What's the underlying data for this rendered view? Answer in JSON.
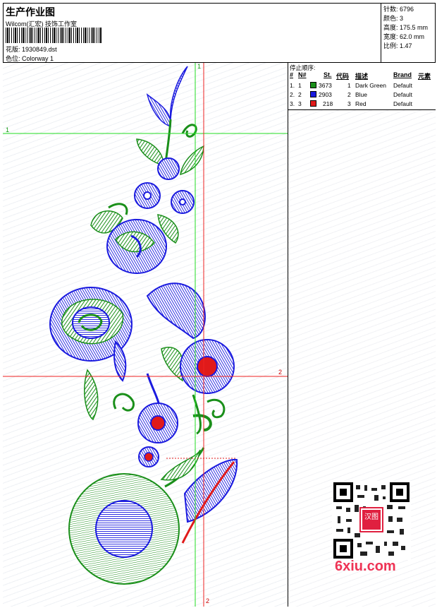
{
  "header": {
    "title": "生产作业图",
    "company": "Wilcom(汇宏) 技饰工作室",
    "file_label": "花版:",
    "file_name": "1930849.dst",
    "colorway_label": "色位:",
    "colorway_name": "Colorway 1"
  },
  "stats": {
    "stitches_label": "针数:",
    "stitches_value": "6796",
    "colors_label": "颜色:",
    "colors_value": "3",
    "height_label": "高度:",
    "height_value": "175.5 mm",
    "width_label": "宽度:",
    "width_value": "62.0 mm",
    "ratio_label": "比例:",
    "ratio_value": "1.47"
  },
  "stop_sequence": {
    "title": "停止顺序:",
    "headers": {
      "num": "#",
      "needle": "N#",
      "stitches": "St.",
      "code": "代码",
      "desc": "描述",
      "brand": "Brand",
      "element": "元素"
    },
    "rows": [
      {
        "num": "1.",
        "needle": "1",
        "stitches": "3673",
        "code": "1",
        "desc": "Dark Green",
        "brand": "Default",
        "color": "#1a8f1a"
      },
      {
        "num": "2.",
        "needle": "2",
        "stitches": "2903",
        "code": "2",
        "desc": "Blue",
        "brand": "Default",
        "color": "#1a1adf"
      },
      {
        "num": "3.",
        "needle": "3",
        "stitches": "218",
        "code": "3",
        "desc": "Red",
        "brand": "Default",
        "color": "#e01a1a"
      }
    ]
  },
  "guides": {
    "green_v": "1",
    "green_h": "1",
    "red_h": "2",
    "red_v": "2"
  },
  "watermark": {
    "text": "6xiu.com",
    "badge": "汉图"
  },
  "colors": {
    "green_thread": "#1a8f1a",
    "blue_thread": "#1a1adf",
    "red_thread": "#e01a1a",
    "green_guide": "#22dd22",
    "red_guide": "#ee2222"
  }
}
